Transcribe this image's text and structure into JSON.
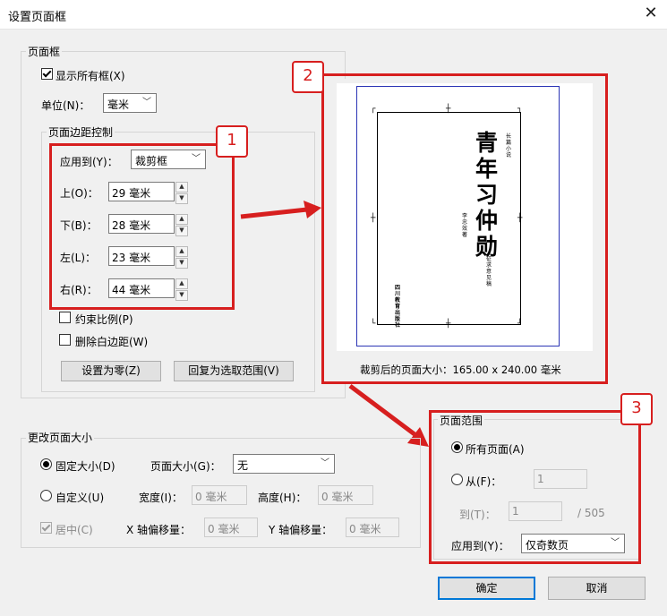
{
  "dialog": {
    "title": "设置页面框"
  },
  "page_box": {
    "group_label": "页面框",
    "show_all_label": "显示所有框(X)",
    "unit_label": "单位(N)：",
    "unit_value": "毫米",
    "margins": {
      "group_label": "页面边距控制",
      "apply_label": "应用到(Y)：",
      "apply_value": "裁剪框",
      "top_label": "上(O)：",
      "top_value": "29 毫米",
      "bottom_label": "下(B)：",
      "bottom_value": "28 毫米",
      "left_label": "左(L)：",
      "left_value": "23 毫米",
      "right_label": "右(R)：",
      "right_value": "44 毫米",
      "constrain_label": "约束比例(P)",
      "remove_white_label": "删除白边距(W)",
      "set_zero_label": "设置为零(Z)",
      "revert_label": "回复为选取范围(V)"
    }
  },
  "preview": {
    "book_title": "青年习仲勋",
    "book_tag": "长篇小说",
    "author": "李忠效 著",
    "subtitle": "征求意见稿",
    "publisher": "四川教育出版社",
    "size_text": "裁剪后的页面大小：165.00 x 240.00 毫米"
  },
  "change_size": {
    "group_label": "更改页面大小",
    "fixed_label": "固定大小(D)",
    "page_size_label": "页面大小(G)：",
    "page_size_value": "无",
    "custom_label": "自定义(U)",
    "width_label": "宽度(I)：",
    "width_value": "0 毫米",
    "height_label": "高度(H)：",
    "height_value": "0 毫米",
    "center_label": "居中(C)",
    "xoff_label": "X 轴偏移量：",
    "xoff_value": "0 毫米",
    "yoff_label": "Y 轴偏移量：",
    "yoff_value": "0 毫米"
  },
  "page_range": {
    "group_label": "页面范围",
    "all_label": "所有页面(A)",
    "from_label": "从(F)：",
    "from_value": "1",
    "to_label": "到(T)：",
    "to_value": "1",
    "total": "/ 505",
    "apply_label": "应用到(Y)：",
    "apply_value": "仅奇数页"
  },
  "buttons": {
    "ok": "确定",
    "cancel": "取消"
  },
  "callouts": {
    "one": "1",
    "two": "2",
    "three": "3"
  },
  "colors": {
    "annotation_red": "#d71f1f",
    "accent_blue": "#0078d7"
  }
}
